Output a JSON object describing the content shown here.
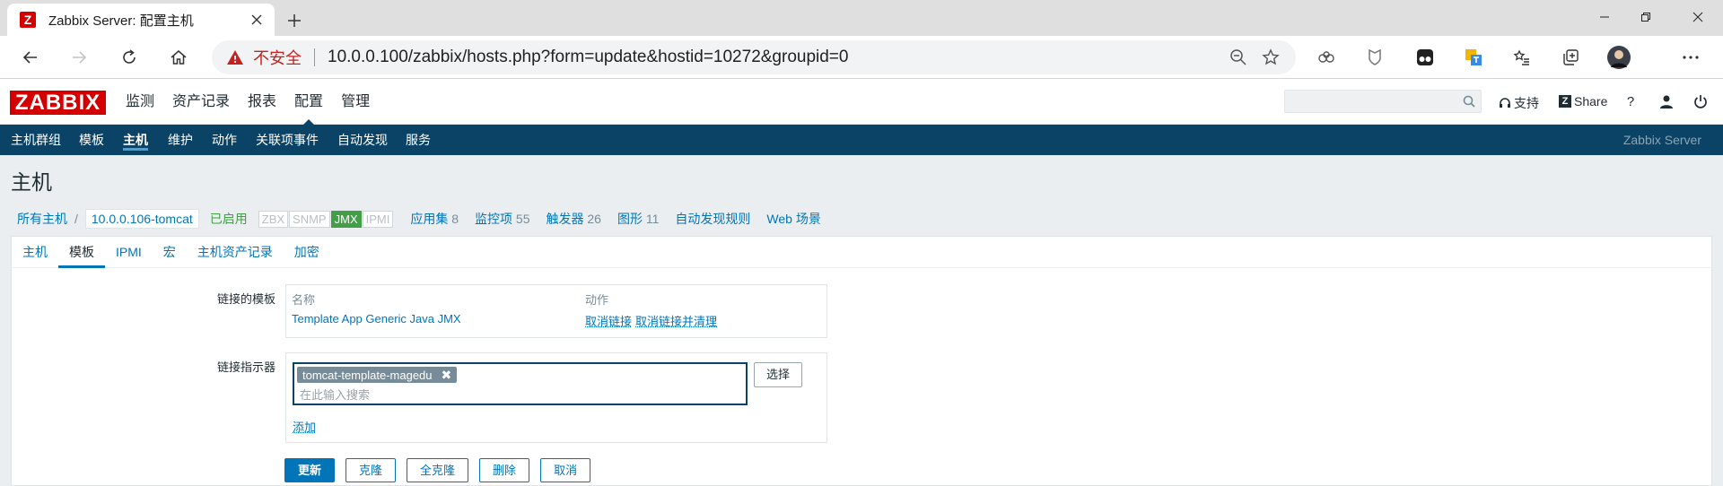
{
  "browser": {
    "tab_title": "Zabbix Server: 配置主机",
    "favicon_letter": "Z",
    "insecure_label": "不安全",
    "url": "10.0.0.100/zabbix/hosts.php?form=update&hostid=10272&groupid=0"
  },
  "zabbix": {
    "logo": "ZABBIX",
    "main_menu": [
      "监测",
      "资产记录",
      "报表",
      "配置",
      "管理"
    ],
    "main_menu_selected": "配置",
    "support": "支持",
    "share": "Share",
    "help": "?",
    "sub_menu": [
      "主机群组",
      "模板",
      "主机",
      "维护",
      "动作",
      "关联项事件",
      "自动发现",
      "服务"
    ],
    "sub_menu_selected": "主机",
    "server_name": "Zabbix Server",
    "page_title": "主机",
    "breadcrumb": {
      "all_hosts": "所有主机",
      "separator": "/",
      "host": "10.0.0.106-tomcat",
      "status": "已启用",
      "availability": [
        {
          "label": "ZBX",
          "active": false
        },
        {
          "label": "SNMP",
          "active": false
        },
        {
          "label": "JMX",
          "active": true
        },
        {
          "label": "IPMI",
          "active": false
        }
      ],
      "links": [
        {
          "label": "应用集",
          "count": "8"
        },
        {
          "label": "监控项",
          "count": "55"
        },
        {
          "label": "触发器",
          "count": "26"
        },
        {
          "label": "图形",
          "count": "11"
        },
        {
          "label": "自动发现规则",
          "count": ""
        },
        {
          "label": "Web 场景",
          "count": ""
        }
      ]
    },
    "form_tabs": [
      "主机",
      "模板",
      "IPMI",
      "宏",
      "主机资产记录",
      "加密"
    ],
    "form_tab_selected": "模板",
    "linked_templates": {
      "label": "链接的模板",
      "col_name": "名称",
      "col_action": "动作",
      "rows": [
        {
          "name": "Template App Generic Java JMX",
          "unlink": "取消链接",
          "unlink_clear": "取消链接并清理"
        }
      ]
    },
    "link_new": {
      "label": "链接指示器",
      "selected_chip": "tomcat-template-magedu",
      "placeholder": "在此输入搜索",
      "select_button": "选择",
      "add_link": "添加"
    },
    "buttons": {
      "update": "更新",
      "clone": "克隆",
      "full_clone": "全克隆",
      "delete": "删除",
      "cancel": "取消"
    },
    "colors": {
      "brand_red": "#d40000",
      "nav_blue": "#0b4366",
      "link_blue": "#0275b8",
      "enabled_green": "#429e47"
    }
  }
}
